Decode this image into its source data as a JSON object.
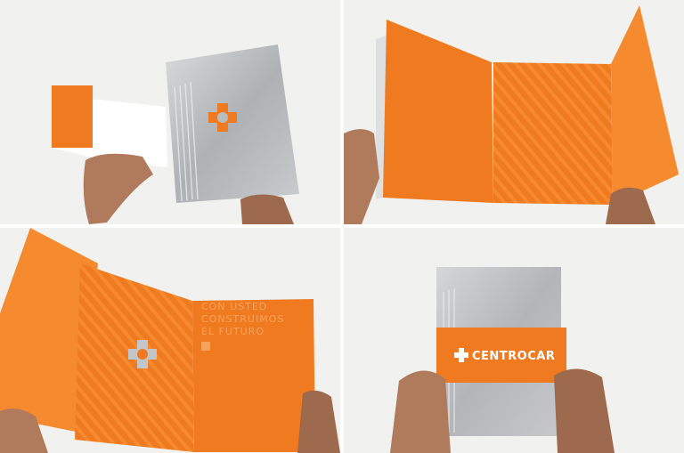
{
  "photos": [
    {
      "id": "closed-brochure-cover"
    },
    {
      "id": "open-spread-fold-out"
    },
    {
      "id": "open-spread-cutout"
    },
    {
      "id": "brochure-with-band"
    }
  ],
  "brand": {
    "name": "CENTROCAR",
    "tagline_lines": [
      "CON USTED",
      "CONSTRUIMOS",
      "EL FUTURO"
    ],
    "logo": "cross-gear-logo-icon"
  },
  "colors": {
    "orange": "#f07a1f",
    "orange_dark": "#d8641a",
    "orange_light": "#f7913a",
    "silver": "#b9bcbe",
    "silver_dark": "#8e9296",
    "paper": "#f3f4f1",
    "skin": "#b07b5c",
    "skin_dark": "#8a5a40"
  }
}
